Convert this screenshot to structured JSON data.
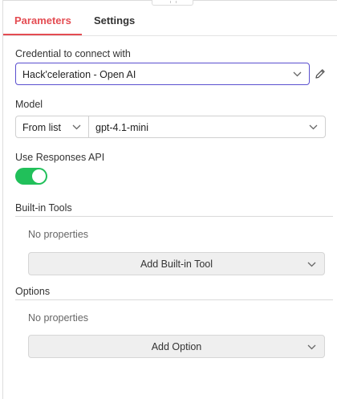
{
  "tabs": {
    "parameters": "Parameters",
    "settings": "Settings"
  },
  "credential": {
    "label": "Credential to connect with",
    "value": "Hack'celeration - Open AI"
  },
  "model": {
    "label": "Model",
    "mode": "From list",
    "value": "gpt-4.1-mini"
  },
  "responses_api": {
    "label": "Use Responses API",
    "enabled": true
  },
  "builtin_tools": {
    "title": "Built-in Tools",
    "empty": "No properties",
    "add_label": "Add Built-in Tool"
  },
  "options": {
    "title": "Options",
    "empty": "No properties",
    "add_label": "Add Option"
  },
  "colors": {
    "accent": "#e44c52",
    "toggle_on": "#21c05a",
    "focus_border": "#5a4fcf"
  }
}
